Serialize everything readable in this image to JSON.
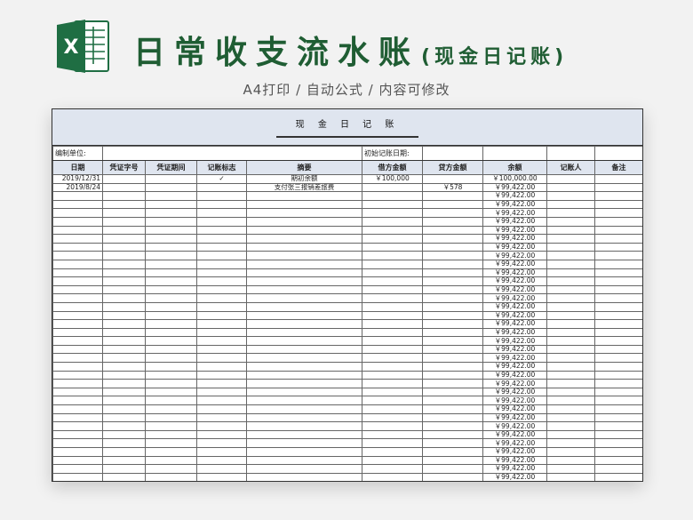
{
  "app": {
    "title": "日常收支流水账",
    "title_sub": "(现金日记账)",
    "subtitle": "A4打印 / 自动公式 / 内容可修改",
    "brand_color": "#1f6e43"
  },
  "sheet": {
    "title": "现 金 日 记 账",
    "unit_label": "编制单位:",
    "initial_date_label": "初始记账日期:",
    "columns": [
      "日期",
      "凭证字号",
      "凭证期间",
      "记账标志",
      "摘要",
      "借方金额",
      "贷方金额",
      "余额",
      "记账人",
      "备注"
    ],
    "rows": [
      {
        "date": "2019/12/31",
        "voucher_no": "",
        "voucher_period": "",
        "mark": "✓",
        "summary": "期初余额",
        "debit": "￥100,000",
        "credit": "",
        "balance": "￥100,000.00",
        "bookkeeper": "",
        "note": ""
      },
      {
        "date": "2019/8/24",
        "voucher_no": "",
        "voucher_period": "",
        "mark": "",
        "summary": "支付张三报销差旅费",
        "debit": "",
        "credit": "￥578",
        "balance": "￥99,422.00",
        "bookkeeper": "",
        "note": ""
      },
      {
        "date": "",
        "balance": "￥99,422.00"
      },
      {
        "date": "",
        "balance": "￥99,422.00"
      },
      {
        "date": "",
        "balance": "￥99,422.00"
      },
      {
        "date": "",
        "balance": "￥99,422.00"
      },
      {
        "date": "",
        "balance": "￥99,422.00"
      },
      {
        "date": "",
        "balance": "￥99,422.00"
      },
      {
        "date": "",
        "balance": "￥99,422.00"
      },
      {
        "date": "",
        "balance": "￥99,422.00"
      },
      {
        "date": "",
        "balance": "￥99,422.00"
      },
      {
        "date": "",
        "balance": "￥99,422.00"
      },
      {
        "date": "",
        "balance": "￥99,422.00"
      },
      {
        "date": "",
        "balance": "￥99,422.00"
      },
      {
        "date": "",
        "balance": "￥99,422.00"
      },
      {
        "date": "",
        "balance": "￥99,422.00"
      },
      {
        "date": "",
        "balance": "￥99,422.00"
      },
      {
        "date": "",
        "balance": "￥99,422.00"
      },
      {
        "date": "",
        "balance": "￥99,422.00"
      },
      {
        "date": "",
        "balance": "￥99,422.00"
      },
      {
        "date": "",
        "balance": "￥99,422.00"
      },
      {
        "date": "",
        "balance": "￥99,422.00"
      },
      {
        "date": "",
        "balance": "￥99,422.00"
      },
      {
        "date": "",
        "balance": "￥99,422.00"
      },
      {
        "date": "",
        "balance": "￥99,422.00"
      },
      {
        "date": "",
        "balance": "￥99,422.00"
      },
      {
        "date": "",
        "balance": "￥99,422.00"
      },
      {
        "date": "",
        "balance": "￥99,422.00"
      },
      {
        "date": "",
        "balance": "￥99,422.00"
      },
      {
        "date": "",
        "balance": "￥99,422.00"
      },
      {
        "date": "",
        "balance": "￥99,422.00"
      },
      {
        "date": "",
        "balance": "￥99,422.00"
      },
      {
        "date": "",
        "balance": "￥99,422.00"
      },
      {
        "date": "",
        "balance": "￥99,422.00"
      },
      {
        "date": "",
        "balance": "￥99,422.00"
      },
      {
        "date": "",
        "balance": "￥99,422.00"
      }
    ]
  }
}
